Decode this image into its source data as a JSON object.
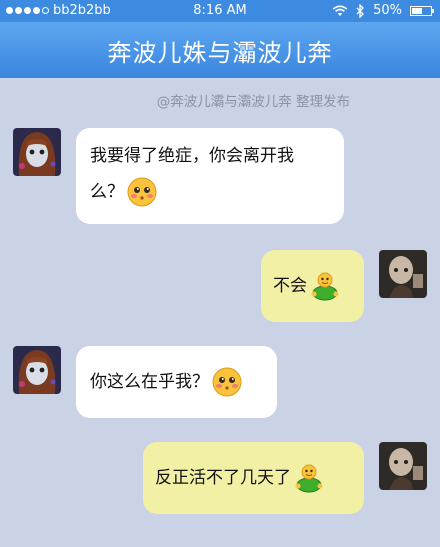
{
  "status_bar": {
    "carrier": "bb2b2bb",
    "time": "8:16 AM",
    "battery": "50%",
    "signal_bars_filled": 4,
    "signal_bars_total": 5,
    "wifi_icon": "wifi-icon",
    "bluetooth_icon": "bluetooth-icon",
    "battery_level": 0.5
  },
  "nav": {
    "title": "奔波儿姝与灞波儿奔"
  },
  "watermark": "@奔波儿灞与灞波儿奔 整理发布",
  "messages": [
    {
      "side": "left",
      "avatar": "girl-avatar",
      "line1": "我要得了绝症，你会离开我",
      "line2": "么？",
      "emoji": "blush-face-emoji"
    },
    {
      "side": "right",
      "avatar": "bald-man-avatar",
      "text": "不会",
      "emoji": "turtle-emoji"
    },
    {
      "side": "left",
      "avatar": "girl-avatar",
      "text": "你这么在乎我？",
      "emoji": "blush-face-emoji"
    },
    {
      "side": "right",
      "avatar": "bald-man-avatar",
      "text": "反正活不了几天了",
      "emoji": "turtle-emoji"
    }
  ],
  "colors": {
    "status_bar": "#3d8be0",
    "nav_bar": "#4a95e8",
    "background": "#c9d3e5",
    "left_bubble": "#ffffff",
    "right_bubble": "#f2f0a4"
  }
}
